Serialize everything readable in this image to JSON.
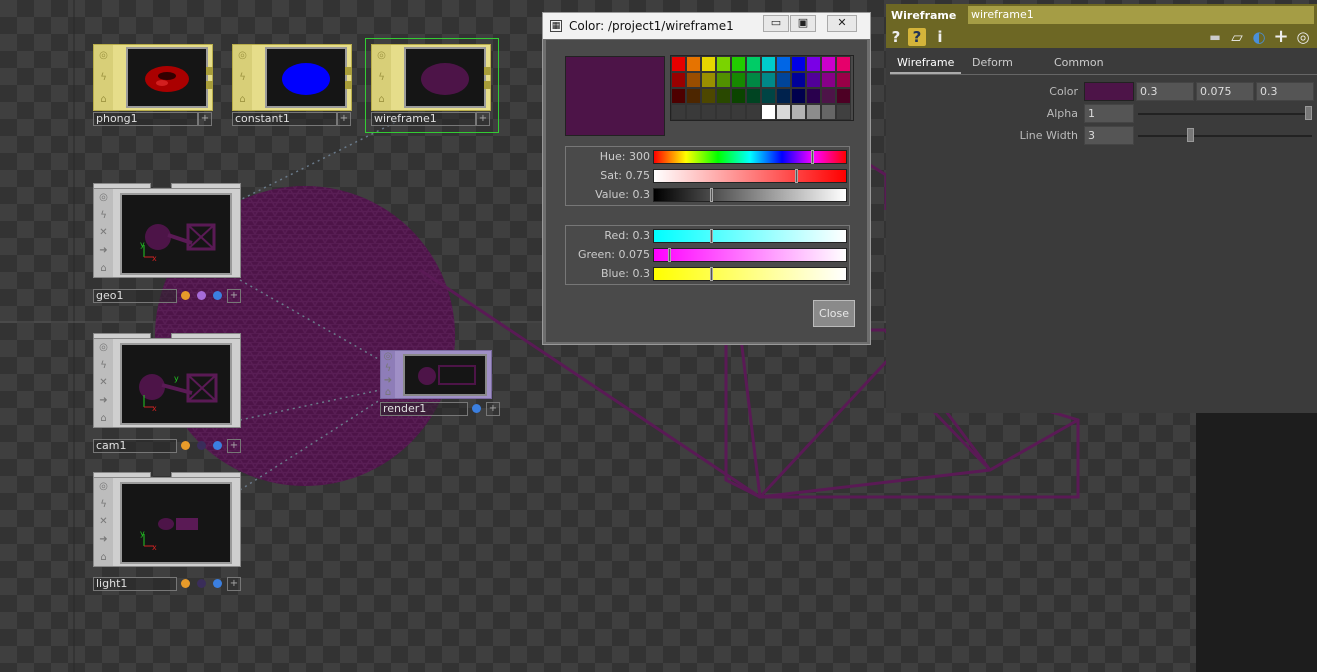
{
  "colors": {
    "accent_purple": "#4d1448",
    "material_yellow": "#e6dd8a",
    "selected_green": "#3c3",
    "panel_header": "#6d6724"
  },
  "nodes": {
    "phong1": {
      "label": "phong1",
      "preview": "red-torus-icon"
    },
    "constant1": {
      "label": "constant1",
      "preview": "blue-disc-icon"
    },
    "wireframe1": {
      "label": "wireframe1",
      "preview": "purple-disc-icon"
    },
    "geo1": {
      "label": "geo1"
    },
    "cam1": {
      "label": "cam1"
    },
    "light1": {
      "label": "light1"
    },
    "render1": {
      "label": "render1"
    },
    "plus_symbol": "+",
    "axis_x": "x",
    "axis_y": "y"
  },
  "strip_icons": {
    "viewer": "◎",
    "bolt": "ϟ",
    "lock": "⌂",
    "cross": "✕",
    "arrow": "➜"
  },
  "color_dialog": {
    "title": "Color:  /project1/wireframe1",
    "title_icon": "▦",
    "min_symbol": "▭",
    "max_symbol": "▣",
    "close_symbol": "✕",
    "close_button": "Close",
    "current_color": "#4d1448",
    "palette": [
      "#e60000",
      "#e67300",
      "#e6d600",
      "#7ad300",
      "#22cc00",
      "#00cc66",
      "#00cccc",
      "#0066e6",
      "#0000e6",
      "#7a00e6",
      "#cc00cc",
      "#e6006b",
      "#990000",
      "#994d00",
      "#998f00",
      "#519000",
      "#178800",
      "#008844",
      "#008888",
      "#004499",
      "#000099",
      "#510099",
      "#880088",
      "#990047",
      "#4d0000",
      "#4d2600",
      "#4d4700",
      "#294800",
      "#0b4400",
      "#004422",
      "#004444",
      "#00224d",
      "#00004d",
      "#29004d",
      "#4d1448",
      "#4d0024"
    ],
    "greys": [
      "#ffffff",
      "#d9d9d9",
      "#b3b3b3",
      "#8c8c8c",
      "#666666",
      "#404040"
    ],
    "hsv": [
      {
        "label": "Hue: 300",
        "value": 0.833
      },
      {
        "label": "Sat: 0.75",
        "value": 0.75
      },
      {
        "label": "Value: 0.3",
        "value": 0.3
      }
    ],
    "rgb": [
      {
        "label": "Red: 0.3",
        "value": 0.3
      },
      {
        "label": "Green: 0.075",
        "value": 0.075
      },
      {
        "label": "Blue: 0.3",
        "value": 0.3
      }
    ]
  },
  "params": {
    "type": "Wireframe",
    "name": "wireframe1",
    "icons": [
      "help-icon",
      "python-help-icon",
      "info-icon",
      "comment-icon",
      "clone-icon",
      "python-icon",
      "add-icon",
      "target-icon"
    ],
    "icon_glyphs": {
      "help": "?",
      "python_help": "?",
      "info": "i",
      "comment": "▬",
      "clone": "▱",
      "python": "◐",
      "add": "+",
      "target": "◎"
    },
    "tabs": [
      "Wireframe",
      "Deform",
      "Common"
    ],
    "color": {
      "label": "Color",
      "r": "0.3",
      "g": "0.075",
      "b": "0.3"
    },
    "alpha": {
      "label": "Alpha",
      "value": "1",
      "fraction": 1.0
    },
    "line_width": {
      "label": "Line Width",
      "value": "3",
      "fraction": 0.3
    }
  }
}
